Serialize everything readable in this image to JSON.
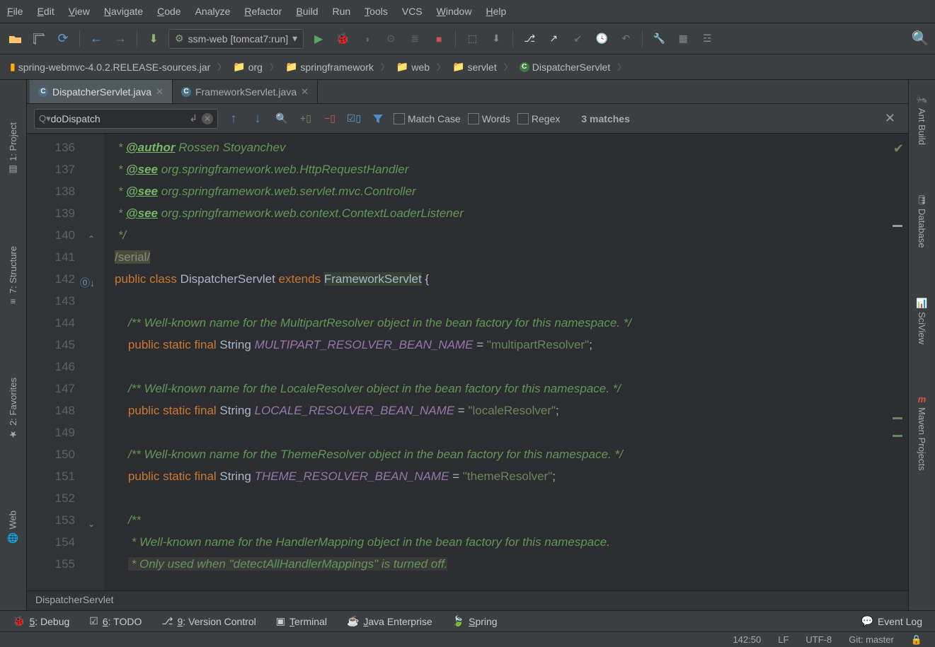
{
  "menu": [
    "File",
    "Edit",
    "View",
    "Navigate",
    "Code",
    "Analyze",
    "Refactor",
    "Build",
    "Run",
    "Tools",
    "VCS",
    "Window",
    "Help"
  ],
  "menu_u": [
    "F",
    "E",
    "V",
    "N",
    "C",
    "",
    "R",
    "B",
    "",
    "T",
    "",
    "W",
    "H"
  ],
  "runconfig": "ssm-web [tomcat7:run]",
  "breadcrumb": [
    {
      "icon": "jar",
      "label": "spring-webmvc-4.0.2.RELEASE-sources.jar"
    },
    {
      "icon": "folder",
      "label": "org"
    },
    {
      "icon": "folder",
      "label": "springframework"
    },
    {
      "icon": "folder",
      "label": "web"
    },
    {
      "icon": "folder",
      "label": "servlet"
    },
    {
      "icon": "class",
      "label": "DispatcherServlet"
    }
  ],
  "tabs": [
    {
      "label": "DispatcherServlet.java",
      "active": true
    },
    {
      "label": "FrameworkServlet.java",
      "active": false
    }
  ],
  "find": {
    "query": "doDispatch",
    "matchcase": "Match Case",
    "words": "Words",
    "regex": "Regex",
    "matches": "3 matches"
  },
  "lineStart": 136,
  "lines": [
    {
      "n": 136,
      "html": "<span class='com'> * <span class='doctag'>@author</span> Rossen Stoyanchev</span>"
    },
    {
      "n": 137,
      "html": "<span class='com'> * <span class='doctag'>@see</span> <span class='docref'>org.springframework.web.HttpRequestHandler</span></span>"
    },
    {
      "n": 138,
      "html": "<span class='com'> * <span class='doctag'>@see</span> <span class='docref'>org.springframework.web.servlet.mvc.Controller</span></span>"
    },
    {
      "n": 139,
      "html": "<span class='com'> * <span class='doctag'>@see</span> <span class='docref'>org.springframework.web.context.ContextLoaderListener</span></span>"
    },
    {
      "n": 140,
      "html": "<span class='com'> */</span>",
      "fold": "end"
    },
    {
      "n": 141,
      "html": "<span style='background:#4a4c3a;color:#888'>/serial/</span>"
    },
    {
      "n": 142,
      "html": "<span class='kw'>public</span> <span class='kw'>class</span> <span class='type'>DispatcherServlet</span> <span class='kw'>extends</span> <span class='hlclass'>FrameworkServlet</span> {",
      "override": true
    },
    {
      "n": 143,
      "html": ""
    },
    {
      "n": 144,
      "html": "    <span class='com'>/** Well-known name for the MultipartResolver object in the bean factory for this namespace. */</span>"
    },
    {
      "n": 145,
      "html": "    <span class='kw'>public</span> <span class='kw'>static</span> <span class='kw'>final</span> <span class='type'>String</span> <span class='const'>MULTIPART_RESOLVER_BEAN_NAME</span> = <span class='str'>\"multipartResolver\"</span>;"
    },
    {
      "n": 146,
      "html": ""
    },
    {
      "n": 147,
      "html": "    <span class='com'>/** Well-known name for the LocaleResolver object in the bean factory for this namespace. */</span>"
    },
    {
      "n": 148,
      "html": "    <span class='kw'>public</span> <span class='kw'>static</span> <span class='kw'>final</span> <span class='type'>String</span> <span class='const'>LOCALE_RESOLVER_BEAN_NAME</span> = <span class='str'>\"localeResolver\"</span>;"
    },
    {
      "n": 149,
      "html": ""
    },
    {
      "n": 150,
      "html": "    <span class='com'>/** Well-known name for the ThemeResolver object in the bean factory for this namespace. */</span>"
    },
    {
      "n": 151,
      "html": "    <span class='kw'>public</span> <span class='kw'>static</span> <span class='kw'>final</span> <span class='type'>String</span> <span class='const'>THEME_RESOLVER_BEAN_NAME</span> = <span class='str'>\"themeResolver\"</span>;"
    },
    {
      "n": 152,
      "html": ""
    },
    {
      "n": 153,
      "html": "    <span class='com'>/**</span>",
      "fold": "start"
    },
    {
      "n": 154,
      "html": "    <span class='com'> * Well-known name for the HandlerMapping object in the bean factory for this namespace.</span>"
    },
    {
      "n": 155,
      "html": "    <span class='com' style='background:#3a3a3a'> * Only used when \"detectAllHandlerMappings\" is turned off.</span>"
    }
  ],
  "crumb_bottom": "DispatcherServlet",
  "leftside": [
    "1: Project",
    "7: Structure",
    "2: Favorites",
    "Web"
  ],
  "rightside": [
    "Ant Build",
    "Database",
    "SciView",
    "Maven Projects"
  ],
  "bottomtools": [
    {
      "icon": "bug",
      "label": "5: Debug"
    },
    {
      "icon": "todo",
      "label": "6: TODO"
    },
    {
      "icon": "vcs",
      "label": "9: Version Control"
    },
    {
      "icon": "term",
      "label": "Terminal"
    },
    {
      "icon": "jee",
      "label": "Java Enterprise"
    },
    {
      "icon": "spring",
      "label": "Spring"
    }
  ],
  "eventlog": "Event Log",
  "status": {
    "pos": "142:50",
    "enc": "UTF-8",
    "git": "Git: master"
  }
}
